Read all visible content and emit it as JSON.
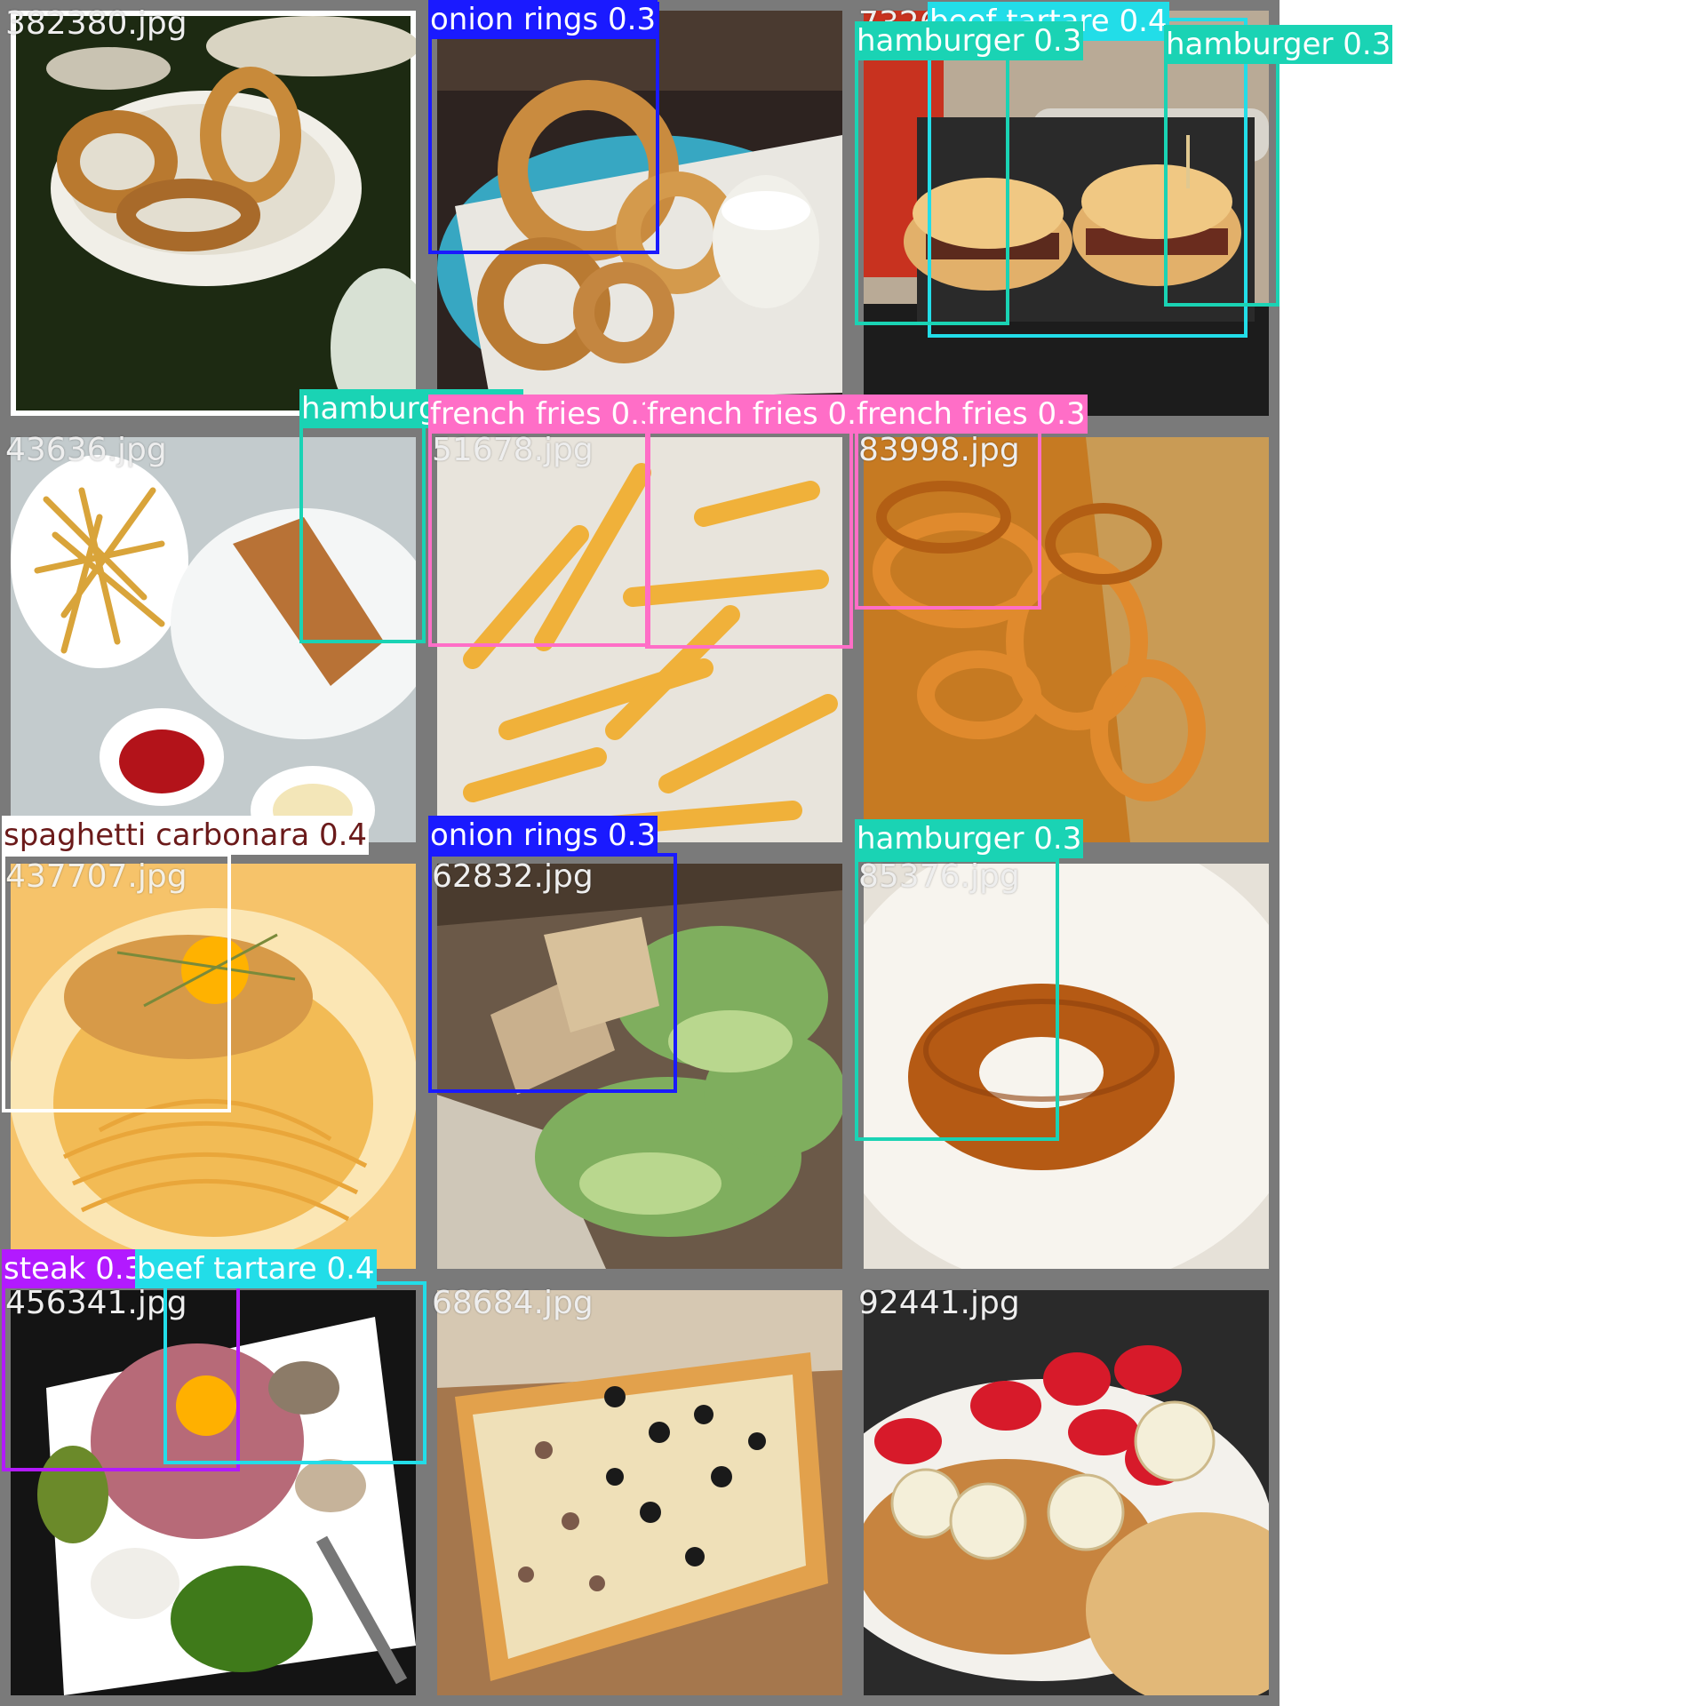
{
  "tiles": [
    {
      "file": "382380.jpg",
      "scene": "onion_rings_bowl"
    },
    {
      "file": "",
      "scene": "onion_rings_basket"
    },
    {
      "file": "7326",
      "scene": "burgers_basket"
    },
    {
      "file": "43636.jpg",
      "scene": "fries_bread"
    },
    {
      "file": "51678.jpg",
      "scene": "fries_plate"
    },
    {
      "file": "83998.jpg",
      "scene": "onion_rings_paper"
    },
    {
      "file": "437707.jpg",
      "scene": "carbonara"
    },
    {
      "file": "62832.jpg",
      "scene": "caesar_salad"
    },
    {
      "file": "85376.jpg",
      "scene": "single_ring"
    },
    {
      "file": "456341.jpg",
      "scene": "tartare"
    },
    {
      "file": "68684.jpg",
      "scene": "pizza"
    },
    {
      "file": "92441.jpg",
      "scene": "pancakes"
    }
  ],
  "detections": [
    {
      "label": "onion rings 0.3",
      "color": "#1a1aff"
    },
    {
      "label": "beef tartare 0.4",
      "color": "#22dde8"
    },
    {
      "label": "hamburger 0.3",
      "color": "#1ad3b4"
    },
    {
      "label": "hamburger 0.3",
      "color": "#1ad3b4"
    },
    {
      "label": "hamburger 0.3",
      "color": "#1ad3b4"
    },
    {
      "label": "french fries 0.3",
      "color": "#ff6ec7"
    },
    {
      "label": "french fries 0.4",
      "color": "#ff6ec7"
    },
    {
      "label": "french fries 0.3",
      "color": "#ff6ec7"
    },
    {
      "label": "spaghetti carbonara 0.4",
      "color": "#ffffff",
      "text_color": "#6b1a1a"
    },
    {
      "label": "onion rings 0.3",
      "color": "#1a1aff"
    },
    {
      "label": "hamburger 0.3",
      "color": "#1ad3b4"
    },
    {
      "label": "steak 0.3",
      "color": "#b21aff"
    },
    {
      "label": "beef tartare 0.4",
      "color": "#22dde8"
    }
  ]
}
